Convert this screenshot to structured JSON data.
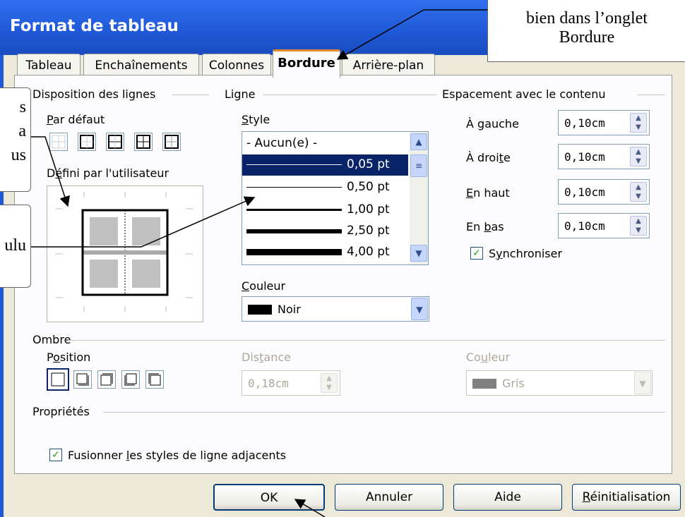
{
  "window": {
    "title": "Format de tableau"
  },
  "tabs": [
    {
      "label": "Tableau"
    },
    {
      "label": "Enchaînements"
    },
    {
      "label": "Colonnes"
    },
    {
      "label": "Bordure",
      "active": true
    },
    {
      "label": "Arrière-plan"
    }
  ],
  "line_arrangement": {
    "group_label": "Disposition des lignes",
    "default_label": "Par défaut",
    "user_defined_label": "Défini par l'utilisateur"
  },
  "line": {
    "group_label": "Ligne",
    "style_label": "Style",
    "styles": [
      {
        "label": "- Aucun(e) -",
        "selected": false
      },
      {
        "label": "0,05 pt",
        "selected": true
      },
      {
        "label": "0,50 pt",
        "selected": false
      },
      {
        "label": "1,00 pt",
        "selected": false
      },
      {
        "label": "2,50 pt",
        "selected": false
      },
      {
        "label": "4,00 pt",
        "selected": false
      }
    ],
    "color_label": "Couleur",
    "color_value": "Noir",
    "color_swatch": "#000000"
  },
  "spacing": {
    "group_label": "Espacement avec le contenu",
    "left_label": "À gauche",
    "left_value": "0,10cm",
    "right_label": "À droite",
    "right_value": "0,10cm",
    "top_label": "En haut",
    "top_value": "0,10cm",
    "bottom_label": "En bas",
    "bottom_value": "0,10cm",
    "sync_label": "Synchroniser",
    "sync_checked": true
  },
  "shadow": {
    "group_label": "Ombre",
    "position_label": "Position",
    "distance_label": "Distance",
    "distance_value": "0,18cm",
    "color_label": "Couleur",
    "color_value": "Gris",
    "color_swatch": "#808080"
  },
  "properties": {
    "group_label": "Propriétés",
    "merge_label": "Fusionner les styles de ligne adjacents",
    "merge_checked": true
  },
  "buttons": {
    "ok": "OK",
    "cancel": "Annuler",
    "help": "Aide",
    "reset": "Réinitialisation"
  },
  "callouts": {
    "top_line1": "bien dans l’onglet",
    "top_line2": "Bordure",
    "left1_line1": "s",
    "left1_line2": "a",
    "left1_line3": "us",
    "left2_text": "ulu"
  }
}
